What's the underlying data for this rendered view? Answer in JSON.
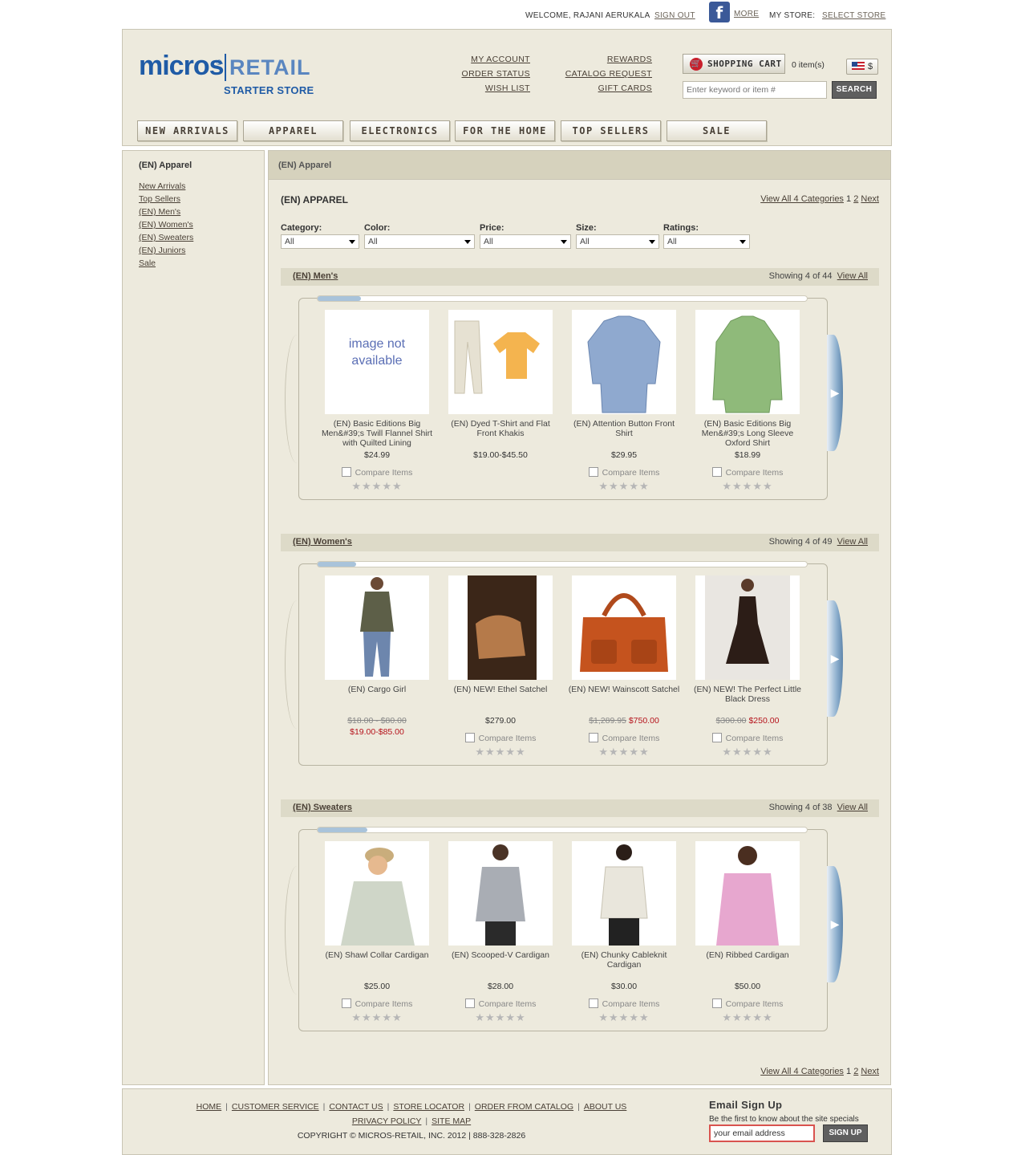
{
  "topbar": {
    "welcome": "WELCOME, RAJANI AERUKALA",
    "sign_out": "SIGN OUT",
    "facebook_more": "MORE",
    "my_store_label": "MY STORE:",
    "select_store": "SELECT STORE"
  },
  "header": {
    "logo": {
      "micros": "micros",
      "retail": "RETAIL",
      "tagline": "STARTER STORE"
    },
    "links_col1": [
      "MY ACCOUNT",
      "ORDER STATUS",
      "WISH LIST"
    ],
    "links_col2": [
      "REWARDS",
      "CATALOG REQUEST",
      "GIFT CARDS"
    ],
    "cart_label": "SHOPPING CART",
    "cart_count": "0 item(s)",
    "currency": "$",
    "search_placeholder": "Enter keyword or item #",
    "search_button": "SEARCH",
    "nav": [
      "NEW ARRIVALS",
      "APPAREL",
      "ELECTRONICS",
      "FOR THE HOME",
      "TOP SELLERS",
      "SALE"
    ]
  },
  "sidebar": {
    "title": "(EN) Apparel",
    "links": [
      "New Arrivals",
      "Top Sellers",
      "(EN) Men's",
      "(EN) Women's",
      "(EN) Sweaters",
      "(EN) Juniors",
      "Sale"
    ]
  },
  "main": {
    "breadcrumb": "(EN) Apparel",
    "title": "(EN) APPAREL",
    "pager": {
      "view_all": "View All 4 Categories",
      "page1": "1",
      "page2": "2",
      "next": "Next"
    },
    "filters": [
      {
        "label": "Category:",
        "value": "All"
      },
      {
        "label": "Color:",
        "value": "All"
      },
      {
        "label": "Price:",
        "value": "All"
      },
      {
        "label": "Size:",
        "value": "All"
      },
      {
        "label": "Ratings:",
        "value": "All"
      }
    ],
    "compare_label": "Compare Items",
    "sections": [
      {
        "name": "(EN) Men's",
        "showing": "Showing 4 of 44",
        "view_all": "View All",
        "products": [
          {
            "name": "(EN) Basic Editions Big Men&#39;s Twill Flannel Shirt with Quilted Lining",
            "price": "$24.99",
            "image_text": "image not available"
          },
          {
            "name": "(EN) Dyed T-Shirt and Flat Front Khakis",
            "price": "$19.00-$45.50"
          },
          {
            "name": "(EN) Attention Button Front Shirt",
            "price": "$29.95"
          },
          {
            "name": "(EN) Basic Editions Big Men&#39;s Long Sleeve Oxford Shirt",
            "price": "$18.99"
          }
        ]
      },
      {
        "name": "(EN) Women's",
        "showing": "Showing 4 of 49",
        "view_all": "View All",
        "products": [
          {
            "name": "(EN) Cargo Girl",
            "old_price": "$18.00 - $80.00",
            "sale_price": "$19.00-$85.00"
          },
          {
            "name": "(EN) NEW! Ethel Satchel",
            "price": "$279.00"
          },
          {
            "name": "(EN) NEW! Wainscott Satchel",
            "old_price": "$1,289.95",
            "sale_price": "$750.00"
          },
          {
            "name": "(EN) NEW! The Perfect Little Black Dress",
            "old_price": "$300.00",
            "sale_price": "$250.00"
          }
        ]
      },
      {
        "name": "(EN) Sweaters",
        "showing": "Showing 4 of 38",
        "view_all": "View All",
        "products": [
          {
            "name": "(EN) Shawl Collar Cardigan",
            "price": "$25.00"
          },
          {
            "name": "(EN) Scooped-V Cardigan",
            "price": "$28.00"
          },
          {
            "name": "(EN) Chunky Cableknit Cardigan",
            "price": "$30.00"
          },
          {
            "name": "(EN) Ribbed Cardigan",
            "price": "$50.00"
          }
        ]
      }
    ]
  },
  "footer": {
    "links_row1": [
      "HOME",
      "CUSTOMER SERVICE",
      "CONTACT US",
      "STORE LOCATOR",
      "ORDER FROM CATALOG",
      "ABOUT US"
    ],
    "links_row2": [
      "PRIVACY POLICY",
      "SITE MAP"
    ],
    "copyright": "COPYRIGHT © MICROS-RETAIL, INC. 2012 | 888-328-2826",
    "email_title": "Email Sign Up",
    "email_sub": "Be the first to know about the site specials",
    "email_placeholder": "your email address",
    "signup_button": "SIGN UP"
  }
}
